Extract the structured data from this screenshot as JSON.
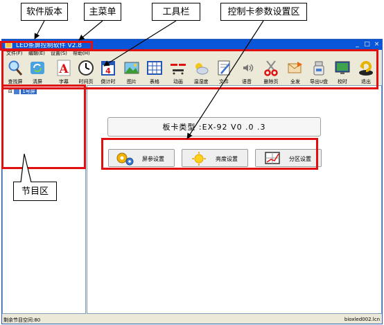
{
  "callouts": {
    "software_version": "软件版本",
    "main_menu": "主菜单",
    "toolbar": "工具栏",
    "control_card_area": "控制卡参数设置区",
    "program_area": "节目区"
  },
  "window": {
    "title": "LED条屏控制软件  V2.8",
    "minimize": "_",
    "maximize": "□",
    "close": "×"
  },
  "menu": [
    "文件(F)",
    "编辑(E)",
    "设置(S)",
    "帮助(H)"
  ],
  "toolbar": [
    {
      "label": "查找屏",
      "icon": "magnifier-icon"
    },
    {
      "label": "清屏",
      "icon": "refresh-icon"
    },
    {
      "label": "字幕",
      "icon": "letter-a-icon"
    },
    {
      "label": "时间页",
      "icon": "clock-icon"
    },
    {
      "label": "倒计时",
      "icon": "calendar-icon"
    },
    {
      "label": "图片",
      "icon": "picture-icon"
    },
    {
      "label": "表格",
      "icon": "table-icon"
    },
    {
      "label": "动画",
      "icon": "animation-icon"
    },
    {
      "label": "温湿度",
      "icon": "weather-icon"
    },
    {
      "label": "文件",
      "icon": "document-icon"
    },
    {
      "label": "语音",
      "icon": "speaker-icon"
    },
    {
      "label": "删除页",
      "icon": "scissors-icon"
    },
    {
      "label": "全发",
      "icon": "send-icon"
    },
    {
      "label": "导出U盘",
      "icon": "usb-icon"
    },
    {
      "label": "校时",
      "icon": "monitor-icon"
    },
    {
      "label": "退出",
      "icon": "exit-icon"
    }
  ],
  "tree": {
    "root": "1号屏"
  },
  "control": {
    "board_type": "板卡类型 :EX-92 V0 .0 .3",
    "screen_settings": "屏参设置",
    "brightness_settings": "亮度设置",
    "partition_settings": "分区设置"
  },
  "status": {
    "left": "剩余节目空间:80",
    "right": "bioxled002.lcn"
  },
  "colors": {
    "annotation_red": "#e01010",
    "titlebar": "#0a56d8"
  }
}
